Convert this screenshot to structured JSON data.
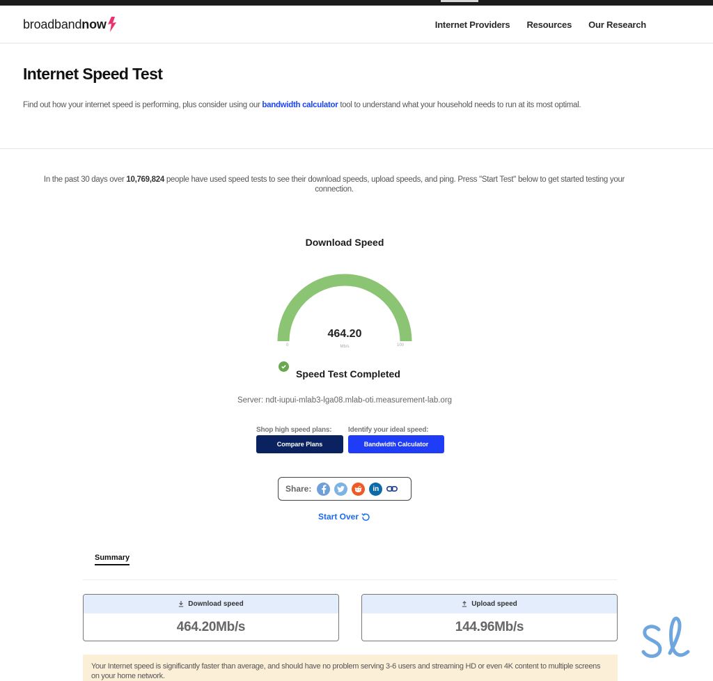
{
  "brand": {
    "name_light": "broadband",
    "name_bold": "now",
    "accent_color": "#e8336b"
  },
  "nav": {
    "items": [
      {
        "label": "Internet Providers"
      },
      {
        "label": "Resources"
      },
      {
        "label": "Our Research"
      }
    ]
  },
  "hero": {
    "title": "Internet Speed Test",
    "intro_before": "Find out how your internet speed is performing, plus consider using our ",
    "intro_link": "bandwidth calculator",
    "intro_after": " tool to understand what your household needs to run at its most optimal."
  },
  "stats": {
    "before": "In the past 30 days over ",
    "count": "10,769,824",
    "after": " people have used speed tests to see their download speeds, upload speeds, and ping. Press \"Start Test\" below to get started testing your connection."
  },
  "gauge": {
    "title": "Download Speed",
    "value": "464.20",
    "unit": "Mb/s",
    "min_label": "0",
    "max_label": "100",
    "fill_fraction": 1.0,
    "color": "#8bc574"
  },
  "status": {
    "label": "Speed Test Completed",
    "color": "#6aa84f"
  },
  "server": {
    "text": "Server: ndt-iupui-mlab3-lga08.mlab-oti.measurement-lab.org"
  },
  "cta": {
    "compare_caption": "Shop high speed plans:",
    "compare_label": "Compare Plans",
    "compare_color": "#0b2260",
    "bandwidth_caption": "Identify your ideal speed:",
    "bandwidth_label": "Bandwidth Calculator",
    "bandwidth_color": "#1f3cf7"
  },
  "share": {
    "label": "Share:",
    "icons": [
      {
        "name": "facebook-icon",
        "glyph": "f",
        "color": "#6f9fd8"
      },
      {
        "name": "twitter-icon",
        "glyph": "t",
        "color": "#7db3e3"
      },
      {
        "name": "reddit-icon",
        "glyph": "r",
        "color": "#ef5a24"
      },
      {
        "name": "linkedin-icon",
        "glyph": "in",
        "color": "#0d6aa8"
      },
      {
        "name": "link-icon",
        "glyph": "⊂⊃",
        "color": "#1a3c8f"
      }
    ]
  },
  "start_over": {
    "label": "Start Over"
  },
  "tabs": {
    "summary_label": "Summary"
  },
  "summary": {
    "download": {
      "label": "Download speed",
      "value": "464.20Mb/s"
    },
    "upload": {
      "label": "Upload speed",
      "value": "144.96Mb/s"
    }
  },
  "note": {
    "text": "Your Internet speed is significantly faster than average, and should have no problem serving 3-6 users and streaming HD or even 4K content to multiple screens on your home network."
  }
}
